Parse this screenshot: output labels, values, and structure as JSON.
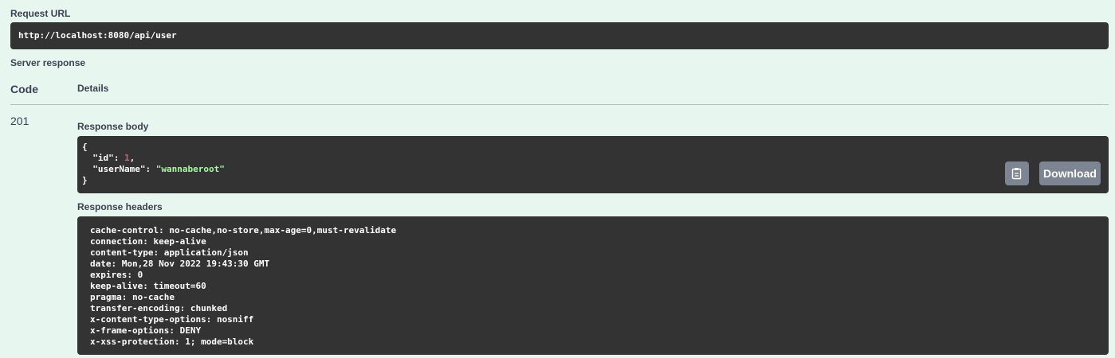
{
  "request_url": {
    "label": "Request URL",
    "value": "http://localhost:8080/api/user"
  },
  "server_response": {
    "label": "Server response",
    "columns": {
      "code": "Code",
      "details": "Details"
    },
    "code": "201",
    "response_body": {
      "label": "Response body",
      "lines": [
        {
          "p1": "{",
          "k": "",
          "v": "",
          "p2": ""
        },
        {
          "p1": "  ",
          "k": "\"id\": ",
          "v": "1",
          "p2": ","
        },
        {
          "p1": "  ",
          "k": "\"userName\": ",
          "v": "\"wannaberoot\"",
          "p2": ""
        },
        {
          "p1": "}",
          "k": "",
          "v": "",
          "p2": ""
        }
      ],
      "copy_icon": "clipboard-icon",
      "download_label": "Download"
    },
    "response_headers": {
      "label": "Response headers",
      "lines": [
        "cache-control: no-cache,no-store,max-age=0,must-revalidate",
        "connection: keep-alive",
        "content-type: application/json",
        "date: Mon,28 Nov 2022 19:43:30 GMT",
        "expires: 0",
        "keep-alive: timeout=60",
        "pragma: no-cache",
        "transfer-encoding: chunked",
        "x-content-type-options: nosniff",
        "x-frame-options: DENY",
        "x-xss-protection: 1; mode=block"
      ]
    }
  },
  "colors": {
    "background": "#e8f6f0",
    "code_bg": "#333333",
    "number": "#d36363",
    "string": "#a2fca2",
    "button": "#7d8492"
  }
}
